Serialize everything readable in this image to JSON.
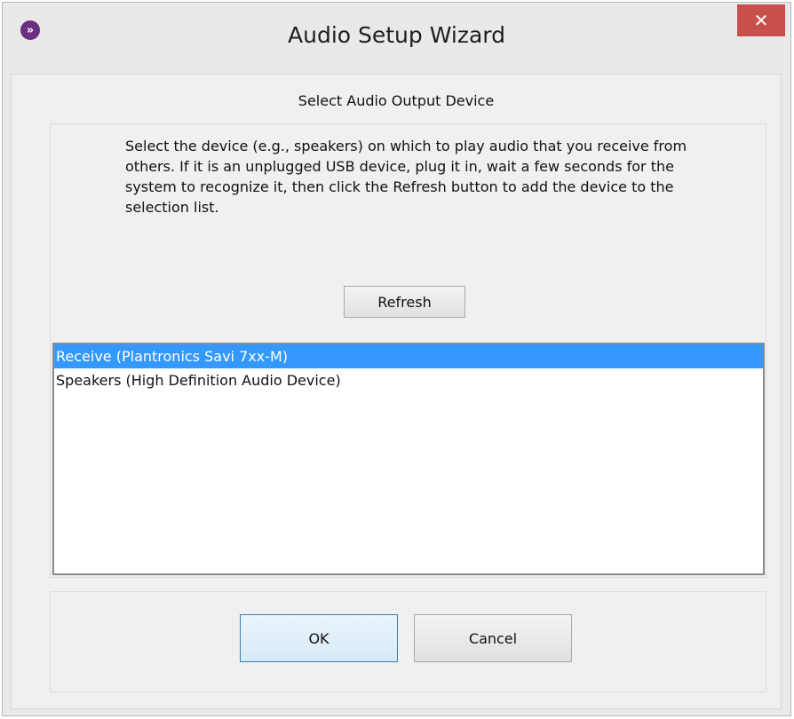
{
  "window": {
    "title": "Audio Setup Wizard",
    "app_icon": "wizard-chevron-icon",
    "close_label": "✕"
  },
  "wizard": {
    "heading": "Select Audio Output Device",
    "description": "Select the device (e.g., speakers) on which to play audio that you receive from others. If it is an unplugged USB device, plug it in, wait a few seconds for the system to recognize it, then click the Refresh button to add the device to the selection list.",
    "refresh_label": "Refresh",
    "devices": [
      {
        "label": "Receive (Plantronics Savi 7xx-M)",
        "selected": true
      },
      {
        "label": "Speakers (High Definition Audio Device)",
        "selected": false
      }
    ]
  },
  "buttons": {
    "ok_label": "OK",
    "cancel_label": "Cancel"
  },
  "colors": {
    "selection": "#3399ff",
    "close_button": "#c7504c",
    "app_icon": "#6b2f7e"
  }
}
